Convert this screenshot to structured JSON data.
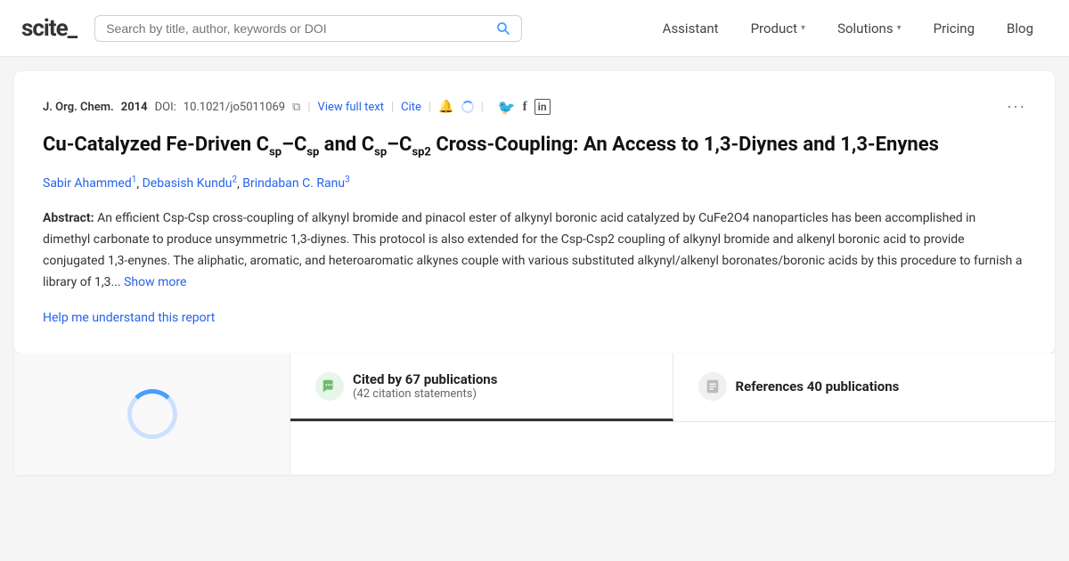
{
  "brand": {
    "name": "scite_",
    "logo_text": "scite",
    "logo_suffix": "_"
  },
  "search": {
    "placeholder": "Search by title, author, keywords or DOI"
  },
  "nav": {
    "items": [
      {
        "label": "Assistant",
        "has_chevron": false
      },
      {
        "label": "Product",
        "has_chevron": true
      },
      {
        "label": "Solutions",
        "has_chevron": true
      },
      {
        "label": "Pricing",
        "has_chevron": false
      },
      {
        "label": "Blog",
        "has_chevron": false
      }
    ]
  },
  "paper": {
    "journal": "J. Org. Chem.",
    "year": "2014",
    "doi_label": "DOI:",
    "doi_value": "10.1021/jo5011069",
    "view_full_text": "View full text",
    "cite": "Cite",
    "title_html": "Cu-Catalyzed Fe-Driven C<sub>sp</sub>–C<sub>sp</sub> and C<sub>sp</sub>–C<sub>sp2</sub> Cross-Coupling: An Access to 1,3-Diynes and 1,3-Enynes",
    "authors": [
      {
        "name": "Sabir Ahammed",
        "sup": "1"
      },
      {
        "name": "Debasish Kundu",
        "sup": "2"
      },
      {
        "name": "Brindaban C. Ranu",
        "sup": "3"
      }
    ],
    "abstract_label": "Abstract:",
    "abstract_text": " An efficient Csp-Csp cross-coupling of alkynyl bromide and pinacol ester of alkynyl boronic acid catalyzed by CuFe2O4 nanoparticles has been accomplished in dimethyl carbonate to produce unsymmetric 1,3-diynes. This protocol is also extended for the Csp-Csp2 coupling of alkynyl bromide and alkenyl boronic acid to provide conjugated 1,3-enynes. The aliphatic, aromatic, and heteroaromatic alkynes couple with various substituted alkynyl/alkenyl boronates/boronic acids by this procedure to furnish a library of 1,3...",
    "show_more": "Show more",
    "help_link": "Help me understand this report"
  },
  "tabs": {
    "cited_by": {
      "label_line1": "Cited by 67",
      "label_line2": "publications",
      "sublabel": "(42 citation",
      "sublabel2": "statements)",
      "icon": "💬"
    },
    "references": {
      "label": "References 40 publications",
      "icon": "📋"
    }
  },
  "social": {
    "twitter": "🐦",
    "facebook": "f",
    "linkedin": "in"
  }
}
